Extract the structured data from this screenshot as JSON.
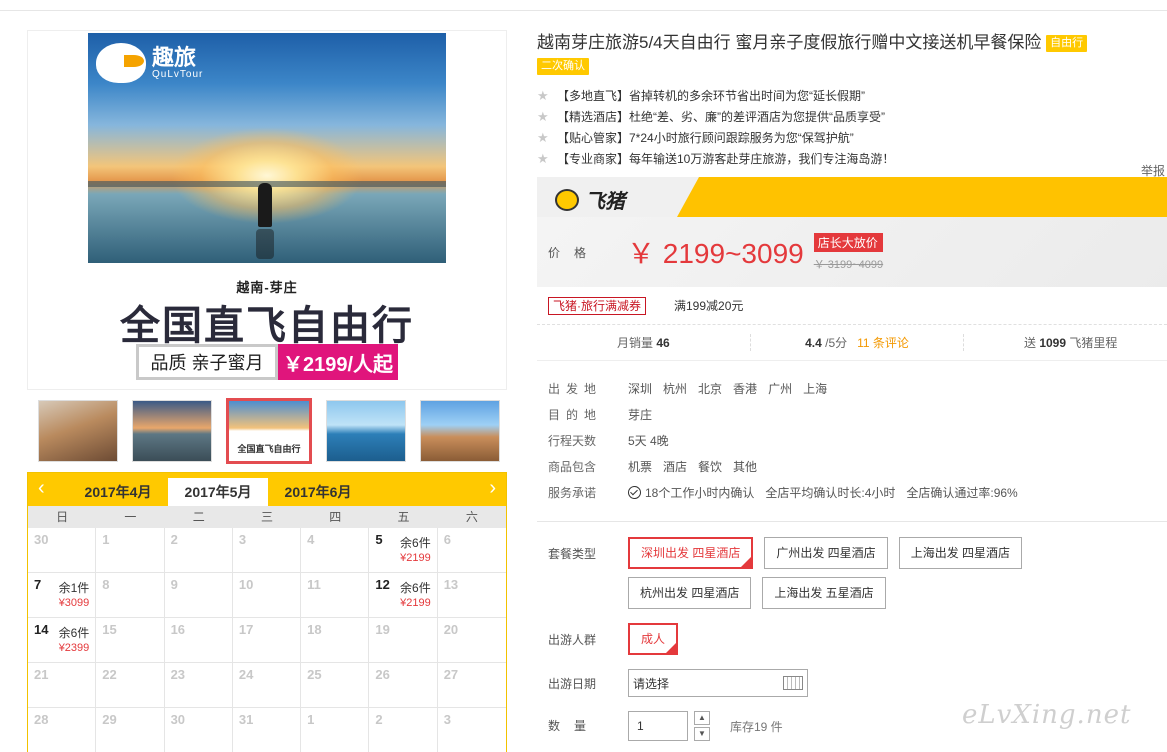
{
  "promo": {
    "logo_text": "趣旅",
    "logo_sub": "QuLvTour",
    "sub": "越南-芽庄",
    "title": "全国直飞自由行",
    "tag": "品质 亲子蜜月",
    "price": "￥2199/人起"
  },
  "thumbnails": [
    {
      "name": "thumb-1",
      "caption": ""
    },
    {
      "name": "thumb-2",
      "caption": ""
    },
    {
      "name": "thumb-3",
      "caption": "全国直飞自由行"
    },
    {
      "name": "thumb-4",
      "caption": ""
    },
    {
      "name": "thumb-5",
      "caption": ""
    }
  ],
  "calendar": {
    "prev_icon": "chevron-left-icon",
    "next_icon": "chevron-right-icon",
    "months": [
      "2017年4月",
      "2017年5月",
      "2017年6月"
    ],
    "active_month": 1,
    "weekdays": [
      "日",
      "一",
      "二",
      "三",
      "四",
      "五",
      "六"
    ],
    "cells": [
      {
        "d": "30",
        "stock": "",
        "price": ""
      },
      {
        "d": "1",
        "stock": "",
        "price": ""
      },
      {
        "d": "2",
        "stock": "",
        "price": ""
      },
      {
        "d": "3",
        "stock": "",
        "price": ""
      },
      {
        "d": "4",
        "stock": "",
        "price": ""
      },
      {
        "d": "5",
        "stock": "余6件",
        "price": "¥2199"
      },
      {
        "d": "6",
        "stock": "",
        "price": ""
      },
      {
        "d": "7",
        "stock": "余1件",
        "price": "¥3099"
      },
      {
        "d": "8",
        "stock": "",
        "price": ""
      },
      {
        "d": "9",
        "stock": "",
        "price": ""
      },
      {
        "d": "10",
        "stock": "",
        "price": ""
      },
      {
        "d": "11",
        "stock": "",
        "price": ""
      },
      {
        "d": "12",
        "stock": "余6件",
        "price": "¥2199"
      },
      {
        "d": "13",
        "stock": "",
        "price": ""
      },
      {
        "d": "14",
        "stock": "余6件",
        "price": "¥2399"
      },
      {
        "d": "15",
        "stock": "",
        "price": ""
      },
      {
        "d": "16",
        "stock": "",
        "price": ""
      },
      {
        "d": "17",
        "stock": "",
        "price": ""
      },
      {
        "d": "18",
        "stock": "",
        "price": ""
      },
      {
        "d": "19",
        "stock": "",
        "price": ""
      },
      {
        "d": "20",
        "stock": "",
        "price": ""
      },
      {
        "d": "21",
        "stock": "",
        "price": ""
      },
      {
        "d": "22",
        "stock": "",
        "price": ""
      },
      {
        "d": "23",
        "stock": "",
        "price": ""
      },
      {
        "d": "24",
        "stock": "",
        "price": ""
      },
      {
        "d": "25",
        "stock": "",
        "price": ""
      },
      {
        "d": "26",
        "stock": "",
        "price": ""
      },
      {
        "d": "27",
        "stock": "",
        "price": ""
      },
      {
        "d": "28",
        "stock": "",
        "price": ""
      },
      {
        "d": "29",
        "stock": "",
        "price": ""
      },
      {
        "d": "30",
        "stock": "",
        "price": ""
      },
      {
        "d": "31",
        "stock": "",
        "price": ""
      },
      {
        "d": "1",
        "stock": "",
        "price": ""
      },
      {
        "d": "2",
        "stock": "",
        "price": ""
      },
      {
        "d": "3",
        "stock": "",
        "price": ""
      }
    ]
  },
  "product": {
    "title": "越南芽庄旅游5/4天自由行 蜜月亲子度假旅行赠中文接送机早餐保险",
    "badge1": "自由行",
    "badge2": "二次确认",
    "features": [
      "【多地直飞】省掉转机的多余环节省出时间为您“延长假期”",
      "【精选酒店】杜绝“差、劣、廉”的差评酒店为您提供“品质享受”",
      "【贴心管家】7*24小时旅行顾问跟踪服务为您“保驾护航”",
      "【专业商家】每年输送10万游客赴芽庄旅游，我们专注海岛游！"
    ],
    "report": "举报"
  },
  "banner": {
    "logo_text": "飞猪"
  },
  "price": {
    "label": "价格",
    "value": "￥ 2199~3099",
    "boss_tag": "店长大放价",
    "original": "￥ 3199~4099"
  },
  "coupon": {
    "tag": "飞猪·旅行满减券",
    "text": "满199减20元"
  },
  "stats": {
    "sales_label": "月销量",
    "sales_value": "46",
    "rating_value": "4.4",
    "rating_suffix": "/5分",
    "reviews": "11 条评论",
    "miles_prefix": "送",
    "miles_value": "1099",
    "miles_suffix": "飞猪里程"
  },
  "info": {
    "depart_label": "出发地",
    "depart_values": [
      "深圳",
      "杭州",
      "北京",
      "香港",
      "广州",
      "上海"
    ],
    "dest_label": "目的地",
    "dest_value": "芽庄",
    "days_label": "行程天数",
    "days_value": "5天 4晚",
    "includes_label": "商品包含",
    "includes_values": [
      "机票",
      "酒店",
      "餐饮",
      "其他"
    ],
    "promise_label": "服务承诺",
    "promise_1": "18个工作小时内确认",
    "promise_2": "全店平均确认时长:4小时",
    "promise_3": "全店确认通过率:96%"
  },
  "options": {
    "package_label": "套餐类型",
    "packages": [
      "深圳出发 四星酒店",
      "广州出发 四星酒店",
      "上海出发 四星酒店",
      "杭州出发 四星酒店",
      "上海出发 五星酒店"
    ],
    "selected_package": 0,
    "group_label": "出游人群",
    "group_value": "成人",
    "date_label": "出游日期",
    "date_placeholder": "请选择",
    "qty_label": "数量",
    "qty_value": "1",
    "stock_text": "库存19 件"
  },
  "watermark": "eLvXing.net",
  "colors": {
    "accent_yellow": "#ffc900",
    "price_red": "#e4393c",
    "promo_pink": "#e0157c"
  }
}
